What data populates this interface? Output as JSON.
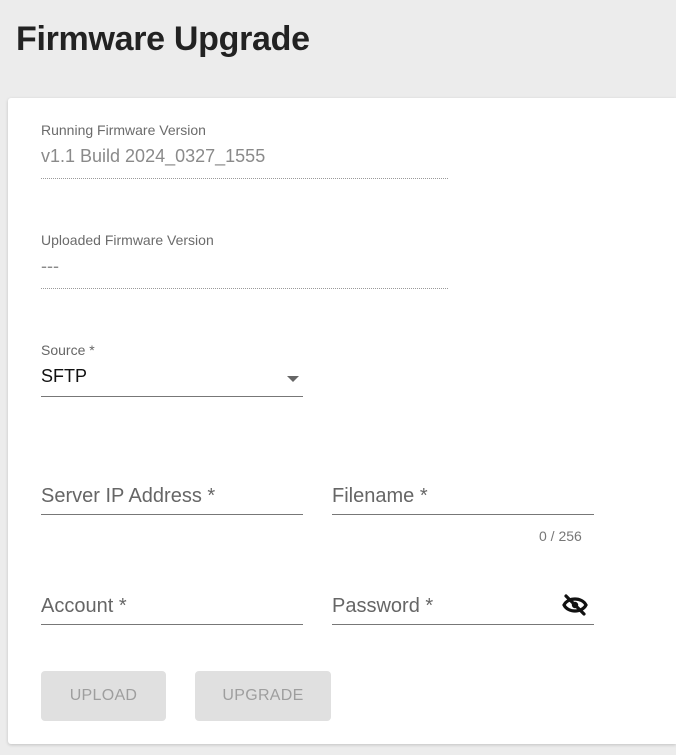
{
  "page": {
    "title": "Firmware Upgrade"
  },
  "running_firmware": {
    "label": "Running Firmware Version",
    "value": "v1.1 Build 2024_0327_1555"
  },
  "uploaded_firmware": {
    "label": "Uploaded Firmware Version",
    "value": "---"
  },
  "source": {
    "label": "Source *",
    "value": "SFTP"
  },
  "server_ip": {
    "placeholder": "Server IP Address *"
  },
  "filename": {
    "placeholder": "Filename *",
    "counter": "0 / 256"
  },
  "account": {
    "placeholder": "Account *"
  },
  "password": {
    "placeholder": "Password *",
    "icon": "eye-off-icon"
  },
  "buttons": {
    "upload": "UPLOAD",
    "upgrade": "UPGRADE"
  }
}
